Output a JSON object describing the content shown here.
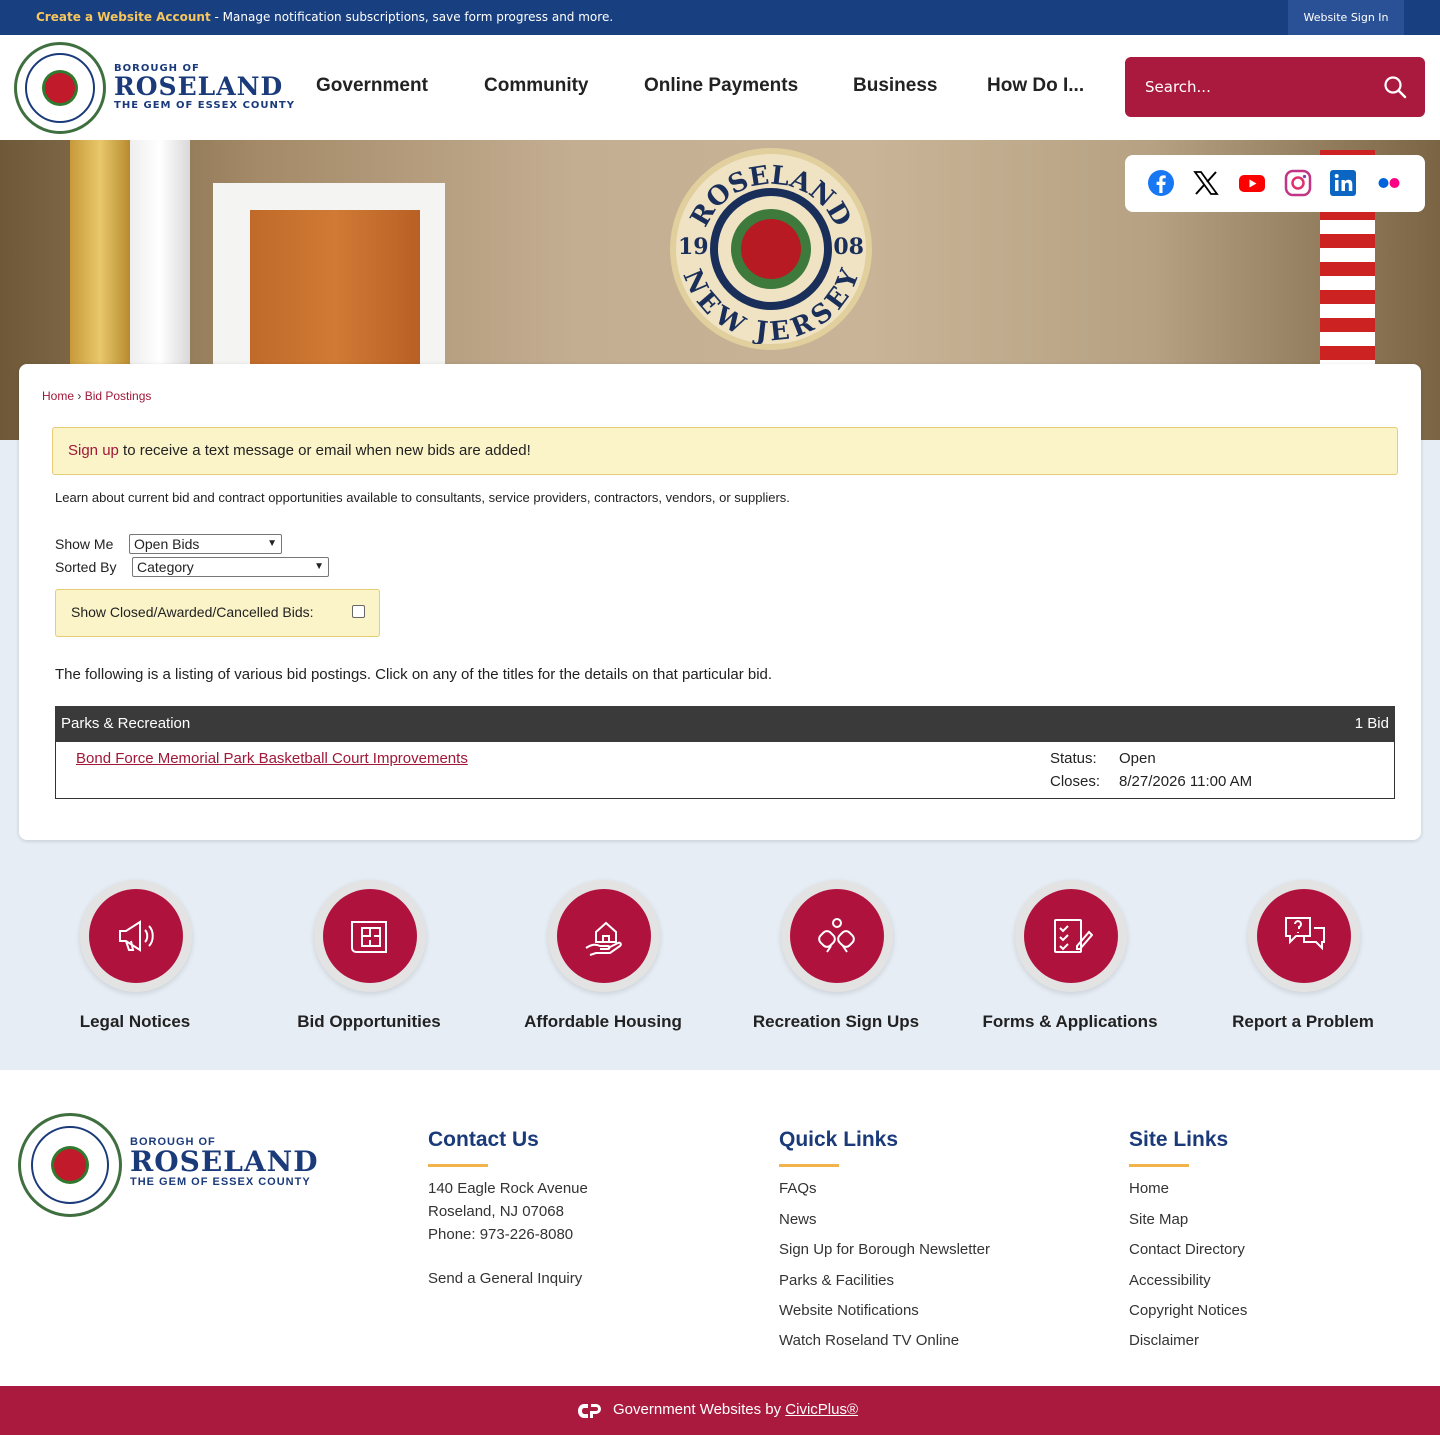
{
  "topbar": {
    "create_account": "Create a Website Account",
    "message": " - Manage notification subscriptions, save form progress and more.",
    "sign_in": "Website Sign In"
  },
  "header": {
    "logo_small": "BOROUGH OF",
    "logo_big": "ROSELAND",
    "logo_tag": "THE GEM OF ESSEX COUNTY",
    "nav": [
      "Government",
      "Community",
      "Online Payments",
      "Business",
      "How Do I..."
    ],
    "search_placeholder": "Search..."
  },
  "banner": {
    "seal_top": "ROSELAND",
    "seal_left": "19",
    "seal_right": "08",
    "seal_bottom": "NEW JERSEY"
  },
  "social": [
    "facebook-icon",
    "x-icon",
    "youtube-icon",
    "instagram-icon",
    "linkedin-icon",
    "flickr-icon"
  ],
  "main": {
    "breadcrumb": [
      "Home",
      "Bid Postings"
    ],
    "notice_link": "Sign up",
    "notice_text": " to receive a text message or email when new bids are added!",
    "intro": "Learn about current bid and contract opportunities available to consultants, service providers, contractors, vendors, or suppliers.",
    "show_me_label": "Show Me",
    "show_me_value": "Open Bids",
    "sorted_by_label": "Sorted By",
    "sorted_by_value": "Category",
    "closed_label": "Show Closed/Awarded/Cancelled Bids:",
    "listing_text": "The following is a listing of various bid postings. Click on any of the titles for the details on that particular bid.",
    "category": "Parks & Recreation",
    "count": "1 Bid",
    "bid": {
      "title": "Bond Force Memorial Park Basketball Court Improvements",
      "status_label": "Status:",
      "status_value": "Open",
      "closes_label": "Closes:",
      "closes_value": "8/27/2026 11:00 AM"
    }
  },
  "quick_icons": [
    {
      "label": "Legal Notices",
      "icon": "megaphone-icon"
    },
    {
      "label": "Bid Opportunities",
      "icon": "blueprint-icon"
    },
    {
      "label": "Affordable Housing",
      "icon": "house-hand-icon"
    },
    {
      "label": "Recreation Sign Ups",
      "icon": "pickleball-icon"
    },
    {
      "label": "Forms & Applications",
      "icon": "checklist-icon"
    },
    {
      "label": "Report a Problem",
      "icon": "question-chat-icon"
    }
  ],
  "footer": {
    "contact_title": "Contact Us",
    "contact_lines": [
      "140 Eagle Rock Avenue",
      "Roseland, NJ 07068",
      "Phone: 973-226-8080"
    ],
    "inquiry": "Send a General Inquiry",
    "quick_title": "Quick Links",
    "quick_links": [
      "FAQs",
      "News",
      "Sign Up for Borough Newsletter",
      "Parks & Facilities",
      "Website Notifications",
      "Watch Roseland TV Online"
    ],
    "site_title": "Site Links",
    "site_links": [
      "Home",
      "Site Map",
      "Contact Directory",
      "Accessibility",
      "Copyright Notices",
      "Disclaimer"
    ]
  },
  "bottom": {
    "text": "Government Websites by ",
    "link": "CivicPlus®"
  },
  "colors": {
    "brand_blue": "#183f80",
    "brand_red": "#aa1a3e",
    "notice_bg": "#fbf4c8",
    "accent_gold": "#f2b44a"
  }
}
